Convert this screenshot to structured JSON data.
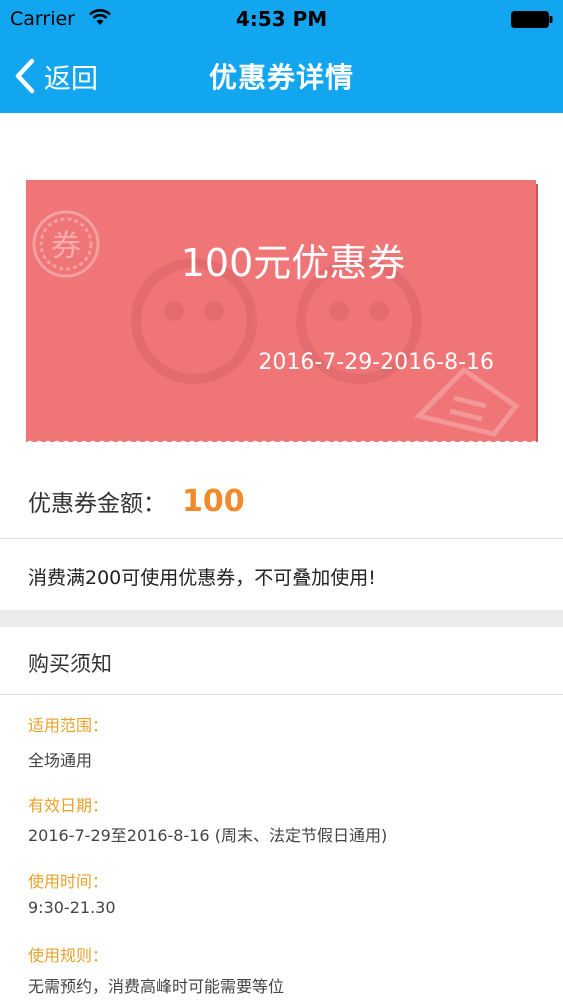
{
  "status_bar": {
    "carrier": "Carrier",
    "time": "4:53 PM",
    "background": "#13a6f0"
  },
  "nav": {
    "back_label": "返回",
    "title": "优惠券详情",
    "back_icon": "chevron-left-icon"
  },
  "coupon": {
    "title": "100元优惠券",
    "date_range": "2016-7-29-2016-8-16",
    "stamp_char": "券",
    "color": "#f07577"
  },
  "amount": {
    "label": "优惠券金额：",
    "value": "100",
    "value_color": "#f08a2a"
  },
  "usage_note": "消费满200可使用优惠券，不可叠加使用!",
  "purchase_notes": {
    "title": "购买须知",
    "items": [
      {
        "label": "适用范围：",
        "value": "全场通用"
      },
      {
        "label": "有效日期：",
        "value": "2016-7-29至2016-8-16 (周末、法定节假日通用)"
      },
      {
        "label": "使用时间：",
        "value": "9:30-21.30"
      },
      {
        "label": "使用规则：",
        "value": "无需预约，消费高峰时可能需要等位"
      }
    ],
    "label_color": "#e9a12c"
  }
}
